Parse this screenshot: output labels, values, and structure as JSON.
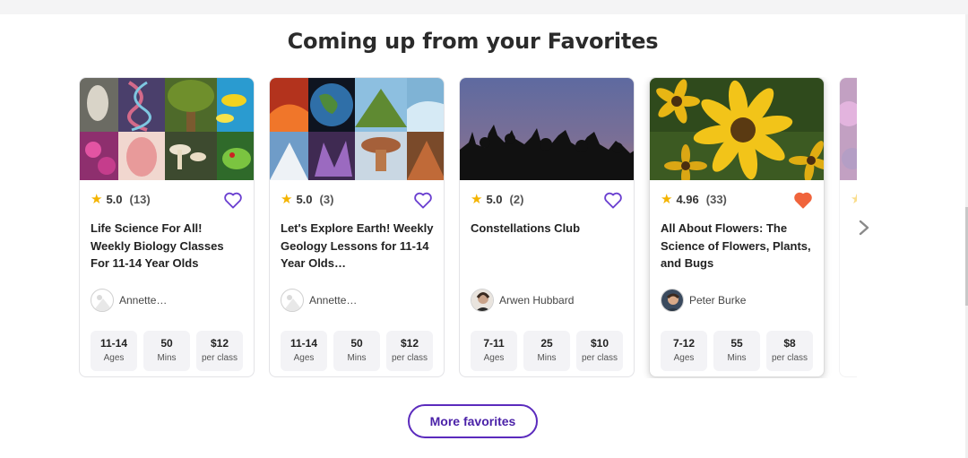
{
  "section": {
    "title": "Coming up from your Favorites"
  },
  "cards": [
    {
      "rating": "5.0",
      "count": "(13)",
      "favorited": false,
      "title": "Life Science For All! Weekly Biology Classes For 11-14 Year Olds",
      "teacher": "Annette…",
      "avatar_icon": "default-avatar-icon",
      "stats": [
        {
          "value": "11-14",
          "unit": "Ages"
        },
        {
          "value": "50",
          "unit": "Mins"
        },
        {
          "value": "$12",
          "unit": "per class"
        }
      ]
    },
    {
      "rating": "5.0",
      "count": "(3)",
      "favorited": false,
      "title": "Let's Explore Earth! Weekly Geology Lessons for 11-14 Year Olds…",
      "teacher": "Annette…",
      "avatar_icon": "default-avatar-icon",
      "stats": [
        {
          "value": "11-14",
          "unit": "Ages"
        },
        {
          "value": "50",
          "unit": "Mins"
        },
        {
          "value": "$12",
          "unit": "per class"
        }
      ]
    },
    {
      "rating": "5.0",
      "count": "(2)",
      "favorited": false,
      "title": "Constellations Club",
      "teacher": "Arwen Hubbard",
      "avatar_icon": "teacher-photo-icon",
      "stats": [
        {
          "value": "7-11",
          "unit": "Ages"
        },
        {
          "value": "25",
          "unit": "Mins"
        },
        {
          "value": "$10",
          "unit": "per class"
        }
      ]
    },
    {
      "rating": "4.96",
      "count": "(33)",
      "favorited": true,
      "title": "All About Flowers: The Science of Flowers, Plants, and Bugs",
      "teacher": "Peter Burke",
      "avatar_icon": "teacher-photo-icon",
      "stats": [
        {
          "value": "7-12",
          "unit": "Ages"
        },
        {
          "value": "55",
          "unit": "Mins"
        },
        {
          "value": "$8",
          "unit": "per class"
        }
      ]
    }
  ],
  "icons": {
    "star": "star-icon",
    "heart": "heart-icon",
    "next": "chevron-right-icon"
  },
  "colors": {
    "heart_outline": "#6a3fd0",
    "heart_filled": "#f0643c",
    "star": "#f4b400",
    "button": "#5b2bbd"
  },
  "more_button": {
    "label": "More favorites"
  }
}
